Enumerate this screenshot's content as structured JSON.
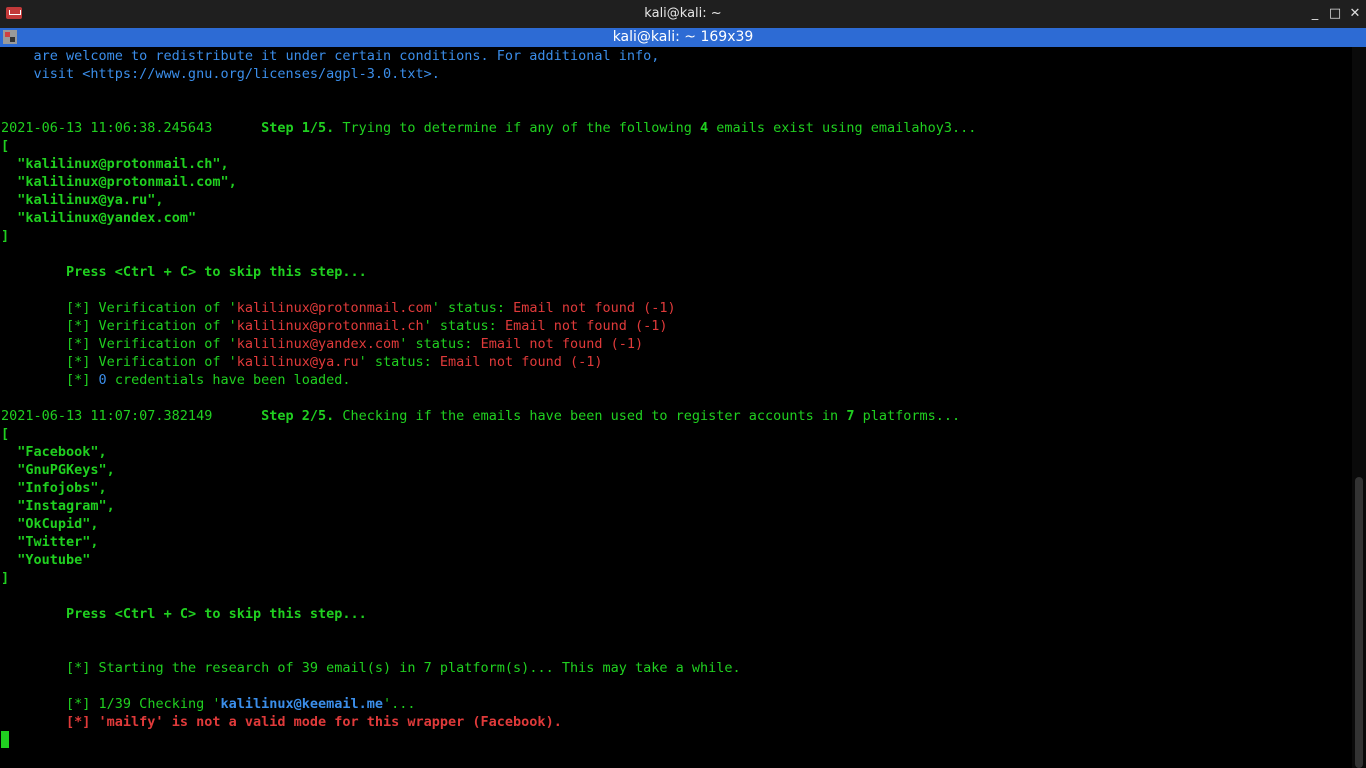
{
  "window": {
    "title": "kali@kali: ~",
    "minimize": "_",
    "maximize": "□",
    "close": "✕"
  },
  "tab": {
    "title": "kali@kali: ~ 169x39"
  },
  "license": {
    "line1": "    are welcome to redistribute it under certain conditions. For additional info,",
    "line2": "    visit <https://www.gnu.org/licenses/agpl-3.0.txt>."
  },
  "step1": {
    "timestamp": "2021-06-13 11:06:38.245643",
    "label": "Step 1/5.",
    "text_a": " Trying to determine if any of the following ",
    "count": "4",
    "text_b": " emails exist using emailahoy3...",
    "emails": [
      "\"kalilinux@protonmail.ch\",",
      "\"kalilinux@protonmail.com\",",
      "\"kalilinux@ya.ru\",",
      "\"kalilinux@yandex.com\""
    ],
    "press": "Press <Ctrl + C> to skip this step...",
    "verifications": [
      {
        "email": "kalilinux@protonmail.com",
        "status": "Email not found (-1)"
      },
      {
        "email": "kalilinux@protonmail.ch",
        "status": "Email not found (-1)"
      },
      {
        "email": "kalilinux@yandex.com",
        "status": "Email not found (-1)"
      },
      {
        "email": "kalilinux@ya.ru",
        "status": "Email not found (-1)"
      }
    ],
    "credentials_count": "0",
    "credentials_text": " credentials have been loaded."
  },
  "step2": {
    "timestamp": "2021-06-13 11:07:07.382149",
    "label": "Step 2/5.",
    "text_a": " Checking if the emails have been used to register accounts in ",
    "count": "7",
    "text_b": " platforms...",
    "platforms": [
      "\"Facebook\",",
      "\"GnuPGKeys\",",
      "\"Infojobs\",",
      "\"Instagram\",",
      "\"OkCupid\",",
      "\"Twitter\",",
      "\"Youtube\""
    ],
    "press": "Press <Ctrl + C> to skip this step...",
    "research": "Starting the research of 39 email(s) in 7 platform(s)... This may take a while.",
    "checking_prefix": "1/39 Checking '",
    "checking_email": "kalilinux@keemail.me",
    "checking_suffix": "'...",
    "error": "[*] 'mailfy' is not a valid mode for this wrapper (Facebook)."
  },
  "common": {
    "bullet": "        [*] ",
    "verif_prefix": "Verification of '",
    "verif_mid": "' status: ",
    "open_bracket": "[",
    "close_bracket": "]",
    "indent2": "  ",
    "indent8": "        ",
    "gap": "      "
  }
}
